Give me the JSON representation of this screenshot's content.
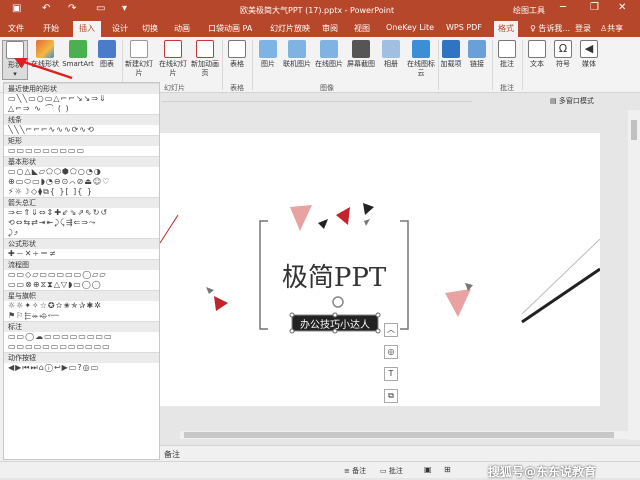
{
  "window": {
    "title": "欧美极简大气PPT (17).pptx - PowerPoint",
    "tool_label": "绘图工具",
    "controls": [
      "minimize-icon",
      "restore-icon",
      "close-icon"
    ]
  },
  "quick_access": [
    "save-icon",
    "undo-icon",
    "redo-icon",
    "present-icon",
    "dropdown-icon"
  ],
  "tabs": [
    "文件",
    "开始",
    "插入",
    "设计",
    "切换",
    "动画",
    "口袋动画 PA",
    "幻灯片放映",
    "审阅",
    "视图",
    "OneKey Lite",
    "WPS PDF",
    "格式"
  ],
  "active_tab": "插入",
  "tell_me": "告诉我...",
  "login": "登录",
  "share": "共享",
  "ribbon": {
    "shapes": "形状",
    "online_shapes": "在线形状",
    "smartart": "SmartArt",
    "chart": "图表",
    "new_slide": "新建幻灯片",
    "online_slide": "在线幻灯片",
    "new_anim_page": "新加动画页",
    "table": "表格",
    "picture": "图片",
    "online_picture_joint": "联机图片",
    "online_picture": "在线图片",
    "screenshot": "屏幕截图",
    "album": "相册",
    "online_icon": "在线图标云",
    "addins": "加载项",
    "link": "链接",
    "comment": "批注",
    "text": "文本",
    "symbol": "符号",
    "media": "媒体",
    "group_slide": "幻灯片",
    "group_table": "表格",
    "group_image": "图像",
    "group_comment": "批注",
    "multi_window": "多窗口模式"
  },
  "shapes_panel": {
    "categories": [
      "最近使用的形状",
      "线条",
      "矩形",
      "基本形状",
      "箭头总汇",
      "公式形状",
      "流程图",
      "星与旗帜",
      "标注",
      "动作按钮"
    ],
    "rows": [
      "▭╲╲▭○▭△⌐⌐↘↘⇒⇓",
      "△⌐⇒ ∿ ⌒ ( )",
      "╲╲╲⌐⌐⌐∿∿∿⟳∿⟲",
      "▭▭▭▭▭▭▭▭▭",
      "▭○△◣▱⬠⬡⬢⬠○◔◑",
      "⊕▭⬭▭◗◔⊖⊙⌒⊘⏏☺♡",
      "⚡☼☽◇⧫⧉{ }[ ]{ }",
      "⇒⇐⇑⇓⇔⇕✚⇙⇘⇗⇖↻↺",
      "⟲⇔⇆⇄⇥⇤⤸⤹⇶⇐⇒⤳",
      "⤸⤴",
      "✚－✕÷＝≠",
      "▭▭◇▱▭▭▭▭▭◯▱▱",
      "▭▭⊗⊕⧖⧗△▽◗▭◯◯",
      "☼☼✦✧☆✪✫✬✯✰✱✲",
      "⚑⚐⬱⬰⬲⬳",
      "▭▭◯☁▭▭▭▭▭▭▭▭",
      "▭▭▭▭▭▭▭▭▭▭▭▭",
      "◀▶⏮⏭⌂ⓘ↩▶▭?◎▭"
    ]
  },
  "slide": {
    "title": "极简PPT",
    "subtitle": "办公技巧小达人"
  },
  "status": {
    "notes_label": "备注",
    "notes_status": "备注",
    "comments_status": "批注",
    "watermark": "搜狐号@东东说教育"
  },
  "colors": {
    "accent": "#b7472a",
    "pink": "#e8a2a2",
    "red": "#c3232a",
    "black": "#222222"
  }
}
